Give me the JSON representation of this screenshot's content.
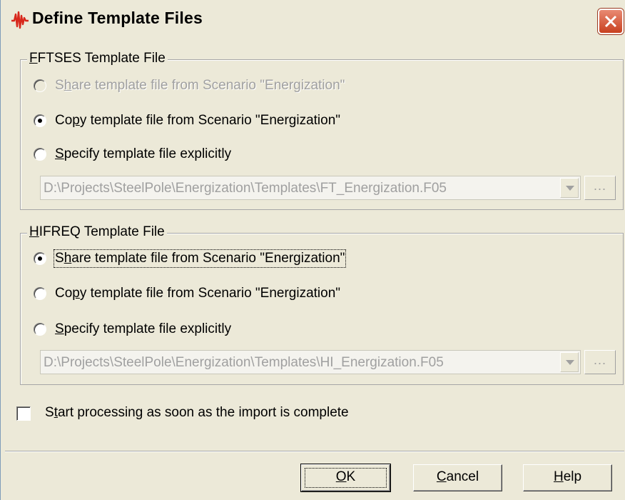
{
  "window": {
    "title": "Define Template Files",
    "icon": "waveform-icon",
    "accent_color": "#d8281c"
  },
  "fftses": {
    "legend_first": "F",
    "legend_rest": "FTSES Template File",
    "options": [
      {
        "pre": "S",
        "mn": "h",
        "post": "are template file from Scenario \"Energization\"",
        "enabled": false,
        "selected": false
      },
      {
        "pre": "Co",
        "mn": "p",
        "post": "y template file from Scenario \"Energization\"",
        "enabled": true,
        "selected": true
      },
      {
        "pre": "",
        "mn": "S",
        "post": "pecify template file explicitly",
        "enabled": true,
        "selected": false
      }
    ],
    "path_value": "D:\\Projects\\SteelPole\\Energization\\Templates\\FT_Energization.F05",
    "browse_label": "..."
  },
  "hifreq": {
    "legend_first": "H",
    "legend_rest": "IFREQ Template File",
    "options": [
      {
        "pre": "S",
        "mn": "h",
        "post": "are template file from Scenario \"Energization\"",
        "enabled": true,
        "selected": true
      },
      {
        "pre": "Co",
        "mn": "p",
        "post": "y template file from Scenario \"Energization\"",
        "enabled": true,
        "selected": false
      },
      {
        "pre": "",
        "mn": "S",
        "post": "pecify template file explicitly",
        "enabled": true,
        "selected": false
      }
    ],
    "path_value": "D:\\Projects\\SteelPole\\Energization\\Templates\\HI_Energization.F05",
    "browse_label": "..."
  },
  "start_processing": {
    "pre": "S",
    "mn": "t",
    "post": "art processing as soon as the import is complete",
    "checked": false
  },
  "buttons": {
    "ok_mn": "O",
    "ok_rest": "K",
    "cancel_mn": "C",
    "cancel_rest": "ancel",
    "help_mn": "H",
    "help_rest": "elp"
  }
}
